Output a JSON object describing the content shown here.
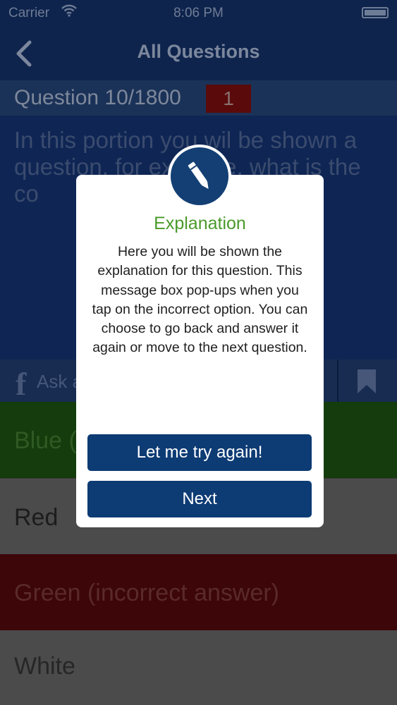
{
  "status_bar": {
    "carrier": "Carrier",
    "time": "8:06 PM"
  },
  "nav": {
    "title": "All Questions",
    "back_icon": "chevron-left-icon"
  },
  "question": {
    "number_label": "Question 10/1800",
    "badge": "1",
    "text": "In this portion you wil be shown a question, for example, what is the co"
  },
  "action_bar": {
    "facebook_glyph": "f",
    "ask_label": "Ask a",
    "bookmark_icon": "bookmark-icon"
  },
  "answers": [
    {
      "label": "Blue (",
      "color": "#143c0c"
    },
    {
      "label": "Red",
      "color": "#4b4b4b"
    },
    {
      "label": "Green (incorrect answer)",
      "color": "#3d0608"
    },
    {
      "label": "White",
      "color": "#4b4b4b"
    }
  ],
  "modal": {
    "icon": "pencil-icon",
    "heading": "Explanation",
    "body": "Here you will be shown the explanation for this question. This message box pop-ups when you tap on the incorrect option. You can choose to go back and answer it again or move to the next question.",
    "retry_button": "Let me try again!",
    "next_button": "Next",
    "accent_color": "#0d3b74",
    "heading_color": "#4a9a2a"
  }
}
